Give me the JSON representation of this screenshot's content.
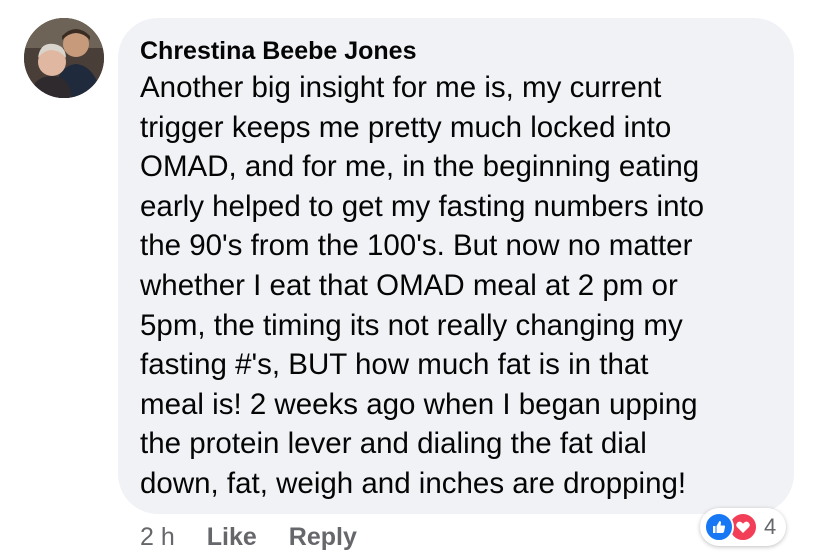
{
  "comment": {
    "author": "Chrestina Beebe Jones",
    "lines": [
      "Another big insight for me is, my current",
      "trigger keeps me pretty much locked into",
      "OMAD, and for me, in the beginning eating",
      "early helped to get my fasting numbers into",
      "the 90's from the 100's. But now no matter",
      "whether I eat that OMAD meal at 2 pm or",
      "5pm, the timing its not really changing my",
      "fasting #'s, BUT how much fat is in that",
      "meal is! 2 weeks ago when I began upping",
      "the protein lever and dialing the fat dial",
      "down, fat, weigh and inches are dropping!"
    ],
    "avatar_icon": "profile-photo"
  },
  "meta": {
    "time": "2 h",
    "like_label": "Like",
    "reply_label": "Reply"
  },
  "reactions": {
    "icons": [
      "like-icon",
      "love-icon"
    ],
    "count": "4",
    "colors": {
      "like": "#1877f2",
      "love": "#f33e58"
    }
  },
  "colors": {
    "bubble": "#f0f2f5",
    "text": "#050505",
    "meta_text": "#65676b"
  }
}
